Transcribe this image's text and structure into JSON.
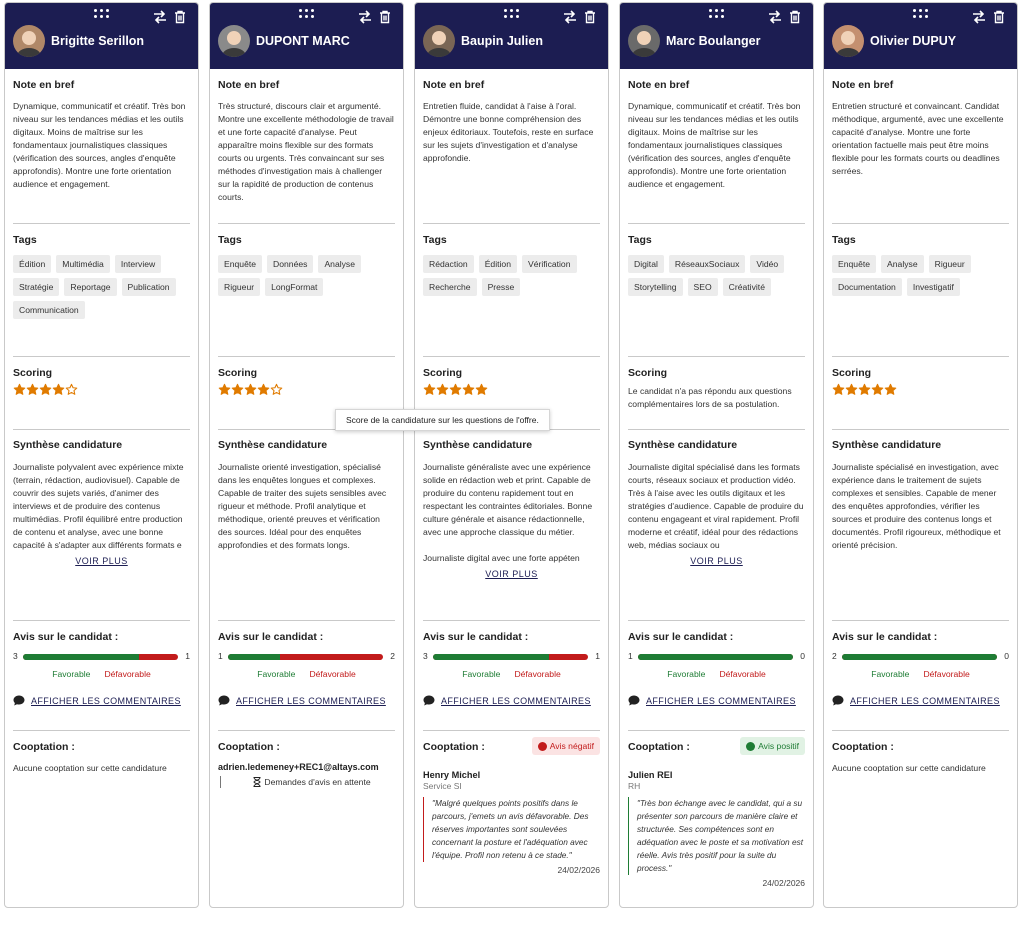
{
  "labels": {
    "note": "Note en bref",
    "tags": "Tags",
    "scoring": "Scoring",
    "synthese": "Synthèse candidature",
    "avis": "Avis sur le candidat :",
    "favorable": "Favorable",
    "defavorable": "Défavorable",
    "afficher_commentaires": "AFFICHER LES COMMENTAIRES",
    "voir_plus": "VOIR PLUS",
    "cooptation": "Cooptation :"
  },
  "tooltip": "Score de la candidature sur les questions de l'offre.",
  "colors": {
    "header": "#1c1d52",
    "favorable": "#1e7c34",
    "defavorable": "#c21b1b",
    "star": "#e07b00"
  },
  "cards": [
    {
      "name": "Brigitte Serillon",
      "note": "Dynamique, communicatif et créatif. Très bon niveau sur les tendances médias et les outils digitaux. Moins de maîtrise sur les fondamentaux journalistiques classiques (vérification des sources, angles d'enquête approfondis). Montre une forte orientation audience et engagement.",
      "tags": [
        "Édition",
        "Multimédia",
        "Interview",
        "Stratégie",
        "Reportage",
        "Publication",
        "Communication"
      ],
      "scoring": 4,
      "scoring_text": "",
      "synthese": "Journaliste polyvalent avec expérience mixte (terrain, rédaction, audiovisuel). Capable de couvrir des sujets variés, d'animer des interviews et de produire des contenus multimédias. Profil équilibré entre production de contenu et analyse, avec une bonne capacité à s'adapter aux différents formats e",
      "synthese_extra": "",
      "has_voir_plus": true,
      "avis": {
        "favorable": 3,
        "defavorable": 1
      },
      "cooptation": {
        "type": "none",
        "text": "Aucune cooptation sur cette candidature"
      }
    },
    {
      "name": "DUPONT MARC",
      "note": "Très structuré, discours clair et argumenté. Montre une excellente méthodologie de travail et une forte capacité d'analyse. Peut apparaître moins flexible sur des formats courts ou urgents. Très convaincant sur ses méthodes d'investigation mais à challenger sur la rapidité de production de contenus courts.",
      "tags": [
        "Enquête",
        "Données",
        "Analyse",
        "Rigueur",
        "LongFormat"
      ],
      "scoring": 4,
      "scoring_text": "",
      "synthese": "Journaliste orienté investigation, spécialisé dans les enquêtes longues et complexes. Capable de traiter des sujets sensibles avec rigueur et méthode. Profil analytique et méthodique, orienté preuves et vérification des sources. Idéal pour des enquêtes approfondies et des formats longs.",
      "synthese_extra": "",
      "has_voir_plus": false,
      "avis": {
        "favorable": 1,
        "defavorable": 2
      },
      "cooptation": {
        "type": "pending",
        "email": "adrien.ledemeney+REC1@altays.com",
        "pending_text": "Demandes d'avis en attente"
      }
    },
    {
      "name": "Baupin Julien",
      "note": "Entretien fluide, candidat à l'aise à l'oral. Démontre une bonne compréhension des enjeux éditoriaux. Toutefois, reste en surface sur les sujets d'investigation et d'analyse approfondie.",
      "tags": [
        "Rédaction",
        "Édition",
        "Vérification",
        "Recherche",
        "Presse"
      ],
      "scoring": 5,
      "scoring_text": "",
      "synthese": "Journaliste généraliste avec une expérience solide en rédaction web et print. Capable de produire du contenu rapidement tout en respectant les contraintes éditoriales. Bonne culture générale et aisance rédactionnelle, avec une approche classique du métier.",
      "synthese_extra": "Journaliste digital avec une forte appéten",
      "has_voir_plus": true,
      "avis": {
        "favorable": 3,
        "defavorable": 1
      },
      "cooptation": {
        "type": "review",
        "badge": "Avis négatif",
        "badge_kind": "neg",
        "reviewer": "Henry Michel",
        "role": "Service SI",
        "quote": "\"Malgré quelques points positifs dans le parcours, j'emets un avis défavorable. Des réserves importantes sont soulevées concernant la posture et l'adéquation avec l'équipe. Profil non retenu à ce stade.\"",
        "date": "24/02/2026"
      }
    },
    {
      "name": "Marc Boulanger",
      "note": "Dynamique, communicatif et créatif. Très bon niveau sur les tendances médias et les outils digitaux. Moins de maîtrise sur les fondamentaux journalistiques classiques (vérification des sources, angles d'enquête approfondis). Montre une forte orientation audience et engagement.",
      "tags": [
        "Digital",
        "RéseauxSociaux",
        "Vidéo",
        "Storytelling",
        "SEO",
        "Créativité"
      ],
      "scoring": 0,
      "scoring_text": "Le candidat n'a pas répondu aux questions complémentaires lors de sa postulation.",
      "synthese": "Journaliste digital spécialisé dans les formats courts, réseaux sociaux et production vidéo. Très à l'aise avec les outils digitaux et les stratégies d'audience. Capable de produire du contenu engageant et viral rapidement. Profil moderne et créatif, idéal pour des rédactions web, médias sociaux ou",
      "synthese_extra": "",
      "has_voir_plus": true,
      "avis": {
        "favorable": 1,
        "defavorable": 0
      },
      "cooptation": {
        "type": "review",
        "badge": "Avis positif",
        "badge_kind": "pos",
        "reviewer": "Julien REI",
        "role": "RH",
        "quote": "\"Très bon échange avec le candidat, qui a su présenter son parcours de manière claire et structurée. Ses compétences sont en adéquation avec le poste et sa motivation est réelle. Avis très positif pour la suite du process.\"",
        "date": "24/02/2026"
      }
    },
    {
      "name": "Olivier DUPUY",
      "note": "Entretien structuré et convaincant. Candidat méthodique, argumenté, avec une excellente capacité d'analyse. Montre une forte orientation factuelle mais peut être moins flexible pour les formats courts ou deadlines serrées.",
      "tags": [
        "Enquête",
        "Analyse",
        "Rigueur",
        "Documentation",
        "Investigatif"
      ],
      "scoring": 5,
      "scoring_text": "",
      "synthese": "Journaliste spécialisé en investigation, avec expérience dans le traitement de sujets complexes et sensibles. Capable de mener des enquêtes approfondies, vérifier les sources et produire des contenus longs et documentés. Profil rigoureux, méthodique et orienté précision.",
      "synthese_extra": "",
      "has_voir_plus": false,
      "avis": {
        "favorable": 2,
        "defavorable": 0
      },
      "cooptation": {
        "type": "none",
        "text": "Aucune cooptation sur cette candidature"
      }
    }
  ]
}
